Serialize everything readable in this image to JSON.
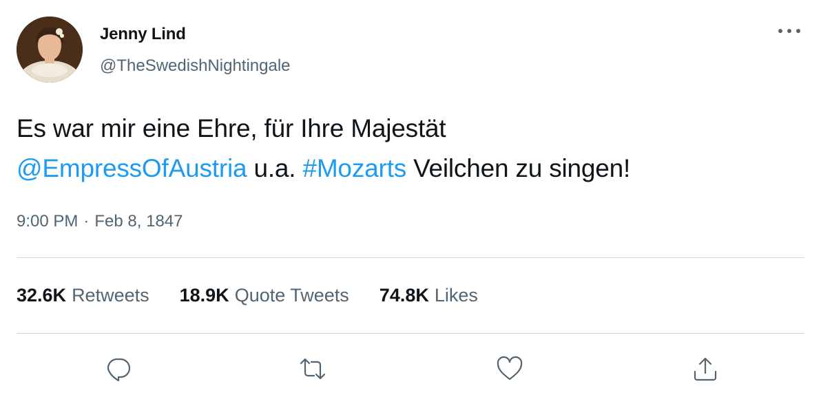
{
  "author": {
    "display_name": "Jenny Lind",
    "handle": "@TheSwedishNightingale"
  },
  "tweet": {
    "text_part1": "Es war mir eine Ehre, für Ihre Majestät",
    "mention": "@EmpressOfAustria",
    "text_part2": " u.a. ",
    "hashtag": "#Mozarts",
    "text_part3": " Veilchen zu singen!",
    "time": "9:00 PM",
    "separator": "·",
    "date": "Feb 8, 1847"
  },
  "stats": {
    "retweets": {
      "value": "32.6K",
      "label": "Retweets"
    },
    "quote_tweets": {
      "value": "18.9K",
      "label": "Quote Tweets"
    },
    "likes": {
      "value": "74.8K",
      "label": "Likes"
    }
  },
  "colors": {
    "link": "#1d9bf0",
    "secondary_text": "#536471",
    "primary_text": "#0f1419",
    "divider": "#cfd9de"
  },
  "icons": {
    "more": "more-horizontal-icon",
    "reply": "reply-icon",
    "retweet": "retweet-icon",
    "like": "heart-icon",
    "share": "share-icon"
  }
}
